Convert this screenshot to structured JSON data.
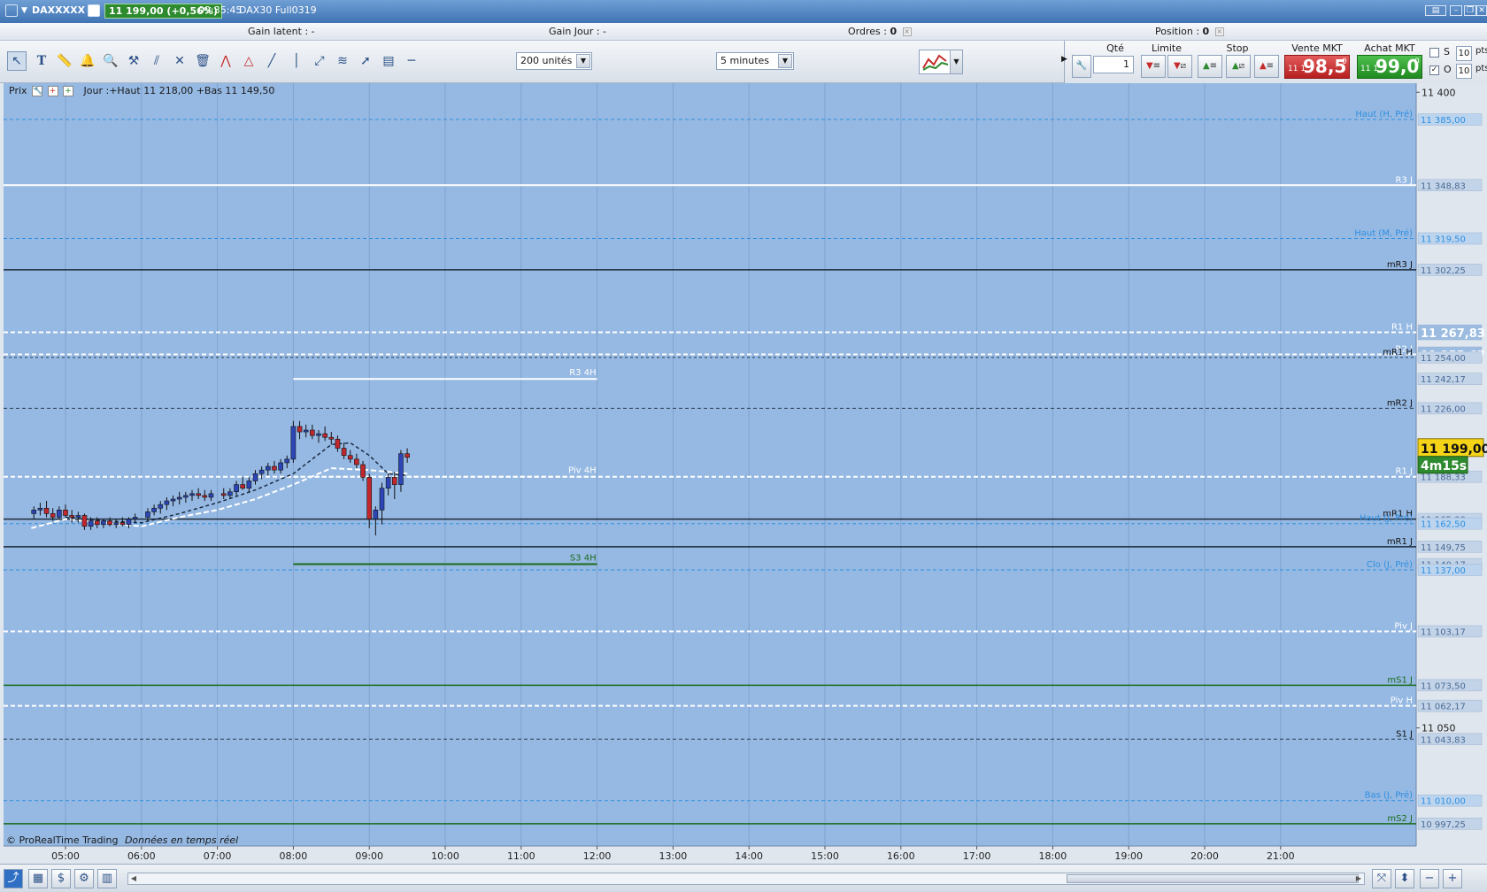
{
  "window": {
    "symbol": "DAXXXXX",
    "last_price_badge": "11 199,00 (+0,56%)",
    "time": "09:35:45",
    "contract": "DAX30 Full0319"
  },
  "status": {
    "gain_latent": "Gain latent : -",
    "gain_jour": "Gain Jour : -",
    "ordres_label": "Ordres :",
    "ordres_value": "0",
    "position_label": "Position :",
    "position_value": "0"
  },
  "toolbar": {
    "units_select": "200 unités",
    "interval_select": "5 minutes"
  },
  "order_panel": {
    "qty_label": "Qté",
    "qty_value": "1",
    "limit_label": "Limite",
    "stop_label": "Stop",
    "sell_label": "Vente MKT",
    "buy_label": "Achat MKT",
    "sell_small": "11 1",
    "sell_big": "98,5",
    "sell_sup": "0",
    "buy_small": "11 1",
    "buy_big": "99,0",
    "buy_sup": "0",
    "s_label": "S",
    "o_label": "O",
    "s_pts": "10",
    "o_pts": "10",
    "pts_label": "pts"
  },
  "chart_header": {
    "prix": "Prix",
    "info": "Jour :+Haut 11 218,00 +Bas 11 149,50"
  },
  "copyright": {
    "brand": "© ProRealTime Trading",
    "feed": "Données en temps réel"
  },
  "colors": {
    "chart_bg": "#96b9e3",
    "bull": "#2c46b8",
    "bear": "#c1272d",
    "level_blue": "#2f8fe0",
    "level_green": "#1a6b1a",
    "price_tag": "#f5d417",
    "timer_tag": "#2e8a2e"
  },
  "chart_data": {
    "type": "candlestick",
    "ylim": [
      10985,
      11405
    ],
    "x_ticks": [
      "05:00",
      "06:00",
      "07:00",
      "08:00",
      "09:00",
      "10:00",
      "11:00",
      "12:00",
      "13:00",
      "14:00",
      "15:00",
      "16:00",
      "17:00",
      "18:00",
      "19:00",
      "20:00",
      "21:00"
    ],
    "y_ticks": [
      "11 400",
      "11 050"
    ],
    "current_price": "11 199,00",
    "countdown": "4m15s",
    "axis_tags": [
      {
        "value": 11385.0,
        "label": "11 385,00",
        "style": "blue"
      },
      {
        "value": 11348.83,
        "label": "11 348,83",
        "style": "light"
      },
      {
        "value": 11319.5,
        "label": "11 319,50",
        "style": "blue"
      },
      {
        "value": 11302.25,
        "label": "11 302,25",
        "style": "light"
      },
      {
        "value": 11267.83,
        "label": "11 267,83",
        "style": "bold"
      },
      {
        "value": 11255.67,
        "label": "11 255,67",
        "style": "bold"
      },
      {
        "value": 11254.0,
        "label": "11 254,00",
        "style": "light"
      },
      {
        "value": 11242.17,
        "label": "11 242,17",
        "style": "light"
      },
      {
        "value": 11226.0,
        "label": "11 226,00",
        "style": "light"
      },
      {
        "value": 11188.33,
        "label": "11 188,33",
        "style": "light"
      },
      {
        "value": 11165.0,
        "label": "11 165,00",
        "style": "light"
      },
      {
        "value": 11162.5,
        "label": "11 162,50",
        "style": "blue"
      },
      {
        "value": 11149.75,
        "label": "11 149,75",
        "style": "light"
      },
      {
        "value": 11140.17,
        "label": "11 140,17",
        "style": "light"
      },
      {
        "value": 11137.0,
        "label": "11 137,00",
        "style": "blue"
      },
      {
        "value": 11103.17,
        "label": "11 103,17",
        "style": "light"
      },
      {
        "value": 11073.5,
        "label": "11 073,50",
        "style": "light"
      },
      {
        "value": 11062.17,
        "label": "11 062,17",
        "style": "light"
      },
      {
        "value": 11043.83,
        "label": "11 043,83",
        "style": "light"
      },
      {
        "value": 11010.0,
        "label": "11 010,00",
        "style": "blue"
      },
      {
        "value": 10997.25,
        "label": "10 997,25",
        "style": "light"
      }
    ],
    "levels": [
      {
        "name": "Haut (H, Pré)",
        "value": 11385.0,
        "style": "dash-blue"
      },
      {
        "name": "R3 J",
        "value": 11348.83,
        "style": "solid-white"
      },
      {
        "name": "Haut (M, Pré)",
        "value": 11319.5,
        "style": "dash-blue"
      },
      {
        "name": "mR3 J",
        "value": 11302.25,
        "style": "solid-black"
      },
      {
        "name": "R1 H",
        "value": 11267.83,
        "style": "dash-white"
      },
      {
        "name": "R2 J",
        "value": 11255.67,
        "style": "dash-white"
      },
      {
        "name": "mR1 H",
        "value": 11254.0,
        "style": "dash-black-thin"
      },
      {
        "name": "mR2 J",
        "value": 11226.0,
        "style": "dash-black"
      },
      {
        "name": "R1 J",
        "value": 11188.33,
        "style": "dash-white"
      },
      {
        "name": "mR1 H",
        "value": 11165.0,
        "style": "solid-black"
      },
      {
        "name": "Haut (J, Pré)",
        "value": 11162.5,
        "style": "dash-blue"
      },
      {
        "name": "mR1 J",
        "value": 11149.75,
        "style": "solid-black"
      },
      {
        "name": "Clo (J, Pré)",
        "value": 11137.0,
        "style": "dash-blue"
      },
      {
        "name": "Piv J",
        "value": 11103.17,
        "style": "dash-white"
      },
      {
        "name": "mS1 J",
        "value": 11073.5,
        "style": "solid-green"
      },
      {
        "name": "Piv H",
        "value": 11062.17,
        "style": "dash-white"
      },
      {
        "name": "S1 J",
        "value": 11043.83,
        "style": "dash-black"
      },
      {
        "name": "Bas (J, Pré)",
        "value": 11010.0,
        "style": "dash-blue"
      },
      {
        "name": "mS2 J",
        "value": 10997.25,
        "style": "solid-green"
      }
    ],
    "segments_4h": [
      {
        "name": "R3 4H",
        "value": 11242.17,
        "from": "08:00",
        "to": "12:00",
        "style": "solid-white"
      },
      {
        "name": "Piv 4H",
        "value": 11188.33,
        "from": "08:00",
        "to": "12:00",
        "style": "dash-white"
      },
      {
        "name": "S3 4H",
        "value": 11140.17,
        "from": "08:00",
        "to": "12:00",
        "style": "solid-green"
      }
    ],
    "candles": [
      {
        "t": "04:35",
        "o": 11168,
        "h": 11172,
        "l": 11165,
        "c": 11170
      },
      {
        "t": "04:40",
        "o": 11170,
        "h": 11174,
        "l": 11167,
        "c": 11171
      },
      {
        "t": "04:45",
        "o": 11171,
        "h": 11175,
        "l": 11166,
        "c": 11168
      },
      {
        "t": "04:50",
        "o": 11168,
        "h": 11171,
        "l": 11164,
        "c": 11166
      },
      {
        "t": "04:55",
        "o": 11166,
        "h": 11172,
        "l": 11165,
        "c": 11170
      },
      {
        "t": "05:00",
        "o": 11170,
        "h": 11173,
        "l": 11166,
        "c": 11167
      },
      {
        "t": "05:05",
        "o": 11167,
        "h": 11170,
        "l": 11163,
        "c": 11166
      },
      {
        "t": "05:10",
        "o": 11166,
        "h": 11169,
        "l": 11163,
        "c": 11167
      },
      {
        "t": "05:15",
        "o": 11167,
        "h": 11168,
        "l": 11159,
        "c": 11161
      },
      {
        "t": "05:20",
        "o": 11161,
        "h": 11166,
        "l": 11159,
        "c": 11164
      },
      {
        "t": "05:25",
        "o": 11164,
        "h": 11166,
        "l": 11160,
        "c": 11162
      },
      {
        "t": "05:30",
        "o": 11162,
        "h": 11165,
        "l": 11160,
        "c": 11164
      },
      {
        "t": "05:35",
        "o": 11164,
        "h": 11166,
        "l": 11161,
        "c": 11162
      },
      {
        "t": "05:40",
        "o": 11162,
        "h": 11165,
        "l": 11160,
        "c": 11163
      },
      {
        "t": "05:45",
        "o": 11163,
        "h": 11166,
        "l": 11161,
        "c": 11162
      },
      {
        "t": "05:50",
        "o": 11162,
        "h": 11166,
        "l": 11160,
        "c": 11165
      },
      {
        "t": "05:55",
        "o": 11165,
        "h": 11168,
        "l": 11163,
        "c": 11166
      },
      {
        "t": "06:05",
        "o": 11166,
        "h": 11171,
        "l": 11164,
        "c": 11169
      },
      {
        "t": "06:10",
        "o": 11169,
        "h": 11173,
        "l": 11167,
        "c": 11171
      },
      {
        "t": "06:15",
        "o": 11171,
        "h": 11175,
        "l": 11168,
        "c": 11173
      },
      {
        "t": "06:20",
        "o": 11173,
        "h": 11177,
        "l": 11170,
        "c": 11175
      },
      {
        "t": "06:25",
        "o": 11175,
        "h": 11178,
        "l": 11172,
        "c": 11176
      },
      {
        "t": "06:30",
        "o": 11176,
        "h": 11180,
        "l": 11173,
        "c": 11177
      },
      {
        "t": "06:35",
        "o": 11177,
        "h": 11180,
        "l": 11174,
        "c": 11178
      },
      {
        "t": "06:40",
        "o": 11178,
        "h": 11181,
        "l": 11175,
        "c": 11179
      },
      {
        "t": "06:45",
        "o": 11179,
        "h": 11182,
        "l": 11176,
        "c": 11178
      },
      {
        "t": "06:50",
        "o": 11178,
        "h": 11181,
        "l": 11175,
        "c": 11177
      },
      {
        "t": "06:55",
        "o": 11177,
        "h": 11181,
        "l": 11175,
        "c": 11179
      },
      {
        "t": "07:05",
        "o": 11179,
        "h": 11182,
        "l": 11176,
        "c": 11178
      },
      {
        "t": "07:10",
        "o": 11178,
        "h": 11182,
        "l": 11176,
        "c": 11180
      },
      {
        "t": "07:15",
        "o": 11180,
        "h": 11186,
        "l": 11178,
        "c": 11184
      },
      {
        "t": "07:20",
        "o": 11184,
        "h": 11188,
        "l": 11181,
        "c": 11182
      },
      {
        "t": "07:25",
        "o": 11182,
        "h": 11188,
        "l": 11180,
        "c": 11186
      },
      {
        "t": "07:30",
        "o": 11186,
        "h": 11192,
        "l": 11184,
        "c": 11190
      },
      {
        "t": "07:35",
        "o": 11190,
        "h": 11194,
        "l": 11187,
        "c": 11192
      },
      {
        "t": "07:40",
        "o": 11192,
        "h": 11196,
        "l": 11189,
        "c": 11194
      },
      {
        "t": "07:45",
        "o": 11194,
        "h": 11197,
        "l": 11190,
        "c": 11192
      },
      {
        "t": "07:50",
        "o": 11192,
        "h": 11198,
        "l": 11190,
        "c": 11196
      },
      {
        "t": "07:55",
        "o": 11196,
        "h": 11200,
        "l": 11193,
        "c": 11198
      },
      {
        "t": "08:00",
        "o": 11198,
        "h": 11219,
        "l": 11196,
        "c": 11216
      },
      {
        "t": "08:05",
        "o": 11216,
        "h": 11219,
        "l": 11209,
        "c": 11213
      },
      {
        "t": "08:10",
        "o": 11213,
        "h": 11217,
        "l": 11210,
        "c": 11214
      },
      {
        "t": "08:15",
        "o": 11214,
        "h": 11217,
        "l": 11209,
        "c": 11211
      },
      {
        "t": "08:20",
        "o": 11211,
        "h": 11214,
        "l": 11207,
        "c": 11212
      },
      {
        "t": "08:25",
        "o": 11212,
        "h": 11216,
        "l": 11208,
        "c": 11210
      },
      {
        "t": "08:30",
        "o": 11210,
        "h": 11213,
        "l": 11206,
        "c": 11209
      },
      {
        "t": "08:35",
        "o": 11209,
        "h": 11211,
        "l": 11202,
        "c": 11204
      },
      {
        "t": "08:40",
        "o": 11204,
        "h": 11207,
        "l": 11198,
        "c": 11200
      },
      {
        "t": "08:45",
        "o": 11200,
        "h": 11203,
        "l": 11196,
        "c": 11198
      },
      {
        "t": "08:50",
        "o": 11198,
        "h": 11201,
        "l": 11193,
        "c": 11195
      },
      {
        "t": "08:55",
        "o": 11195,
        "h": 11197,
        "l": 11186,
        "c": 11188
      },
      {
        "t": "09:00",
        "o": 11188,
        "h": 11190,
        "l": 11160,
        "c": 11165
      },
      {
        "t": "09:05",
        "o": 11165,
        "h": 11172,
        "l": 11156,
        "c": 11170
      },
      {
        "t": "09:10",
        "o": 11170,
        "h": 11185,
        "l": 11162,
        "c": 11182
      },
      {
        "t": "09:15",
        "o": 11182,
        "h": 11190,
        "l": 11178,
        "c": 11188
      },
      {
        "t": "09:20",
        "o": 11188,
        "h": 11191,
        "l": 11176,
        "c": 11184
      },
      {
        "t": "09:25",
        "o": 11184,
        "h": 11203,
        "l": 11180,
        "c": 11201
      },
      {
        "t": "09:30",
        "o": 11201,
        "h": 11204,
        "l": 11196,
        "c": 11199
      }
    ],
    "ma_fast": [
      [
        5.0,
        11166
      ],
      [
        5.5,
        11164
      ],
      [
        6.0,
        11163
      ],
      [
        6.5,
        11168
      ],
      [
        7.0,
        11174
      ],
      [
        7.5,
        11181
      ],
      [
        8.0,
        11190
      ],
      [
        8.25,
        11198
      ],
      [
        8.5,
        11206
      ],
      [
        8.75,
        11207
      ],
      [
        9.0,
        11200
      ],
      [
        9.25,
        11190
      ],
      [
        9.5,
        11189
      ]
    ],
    "ma_slow": [
      [
        4.55,
        11160
      ],
      [
        5.0,
        11165
      ],
      [
        5.5,
        11163
      ],
      [
        6.0,
        11161
      ],
      [
        6.5,
        11166
      ],
      [
        7.0,
        11170
      ],
      [
        7.5,
        11176
      ],
      [
        8.0,
        11184
      ],
      [
        8.5,
        11193
      ],
      [
        9.0,
        11192
      ],
      [
        9.5,
        11190
      ]
    ]
  }
}
